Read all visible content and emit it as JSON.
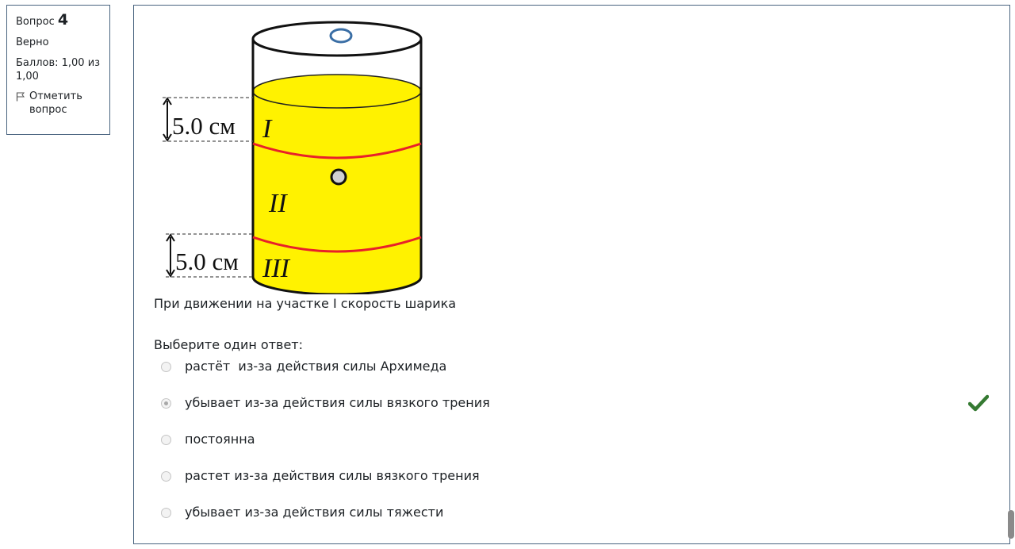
{
  "info": {
    "question_label": "Вопрос",
    "question_number": "4",
    "state": "Верно",
    "grade": "Баллов: 1,00 из 1,00",
    "flag_label": "Отметить вопрос",
    "flag_icon": "flag-icon"
  },
  "figure": {
    "top_measure": "5.0 см",
    "bottom_measure": "5.0 см",
    "region_1": "I",
    "region_2": "II",
    "region_3": "III",
    "colors": {
      "liquid": "#fff200",
      "markers": "#e8202a",
      "ring": "#3a6ea5"
    }
  },
  "question": {
    "text": "При движении на участке I скорость шарика",
    "prompt": "Выберите один ответ:"
  },
  "answers": [
    {
      "label": "растёт  из-за действия силы Архимеда",
      "selected": false
    },
    {
      "label": "убывает из-за действия силы вязкого трения",
      "selected": true
    },
    {
      "label": "постоянна",
      "selected": false
    },
    {
      "label": "растет из-за действия силы вязкого трения",
      "selected": false
    },
    {
      "label": "убывает из-за действия силы тяжести",
      "selected": false
    }
  ],
  "status_colors": {
    "correct": "#357a32"
  },
  "correct_icon": "check-icon"
}
